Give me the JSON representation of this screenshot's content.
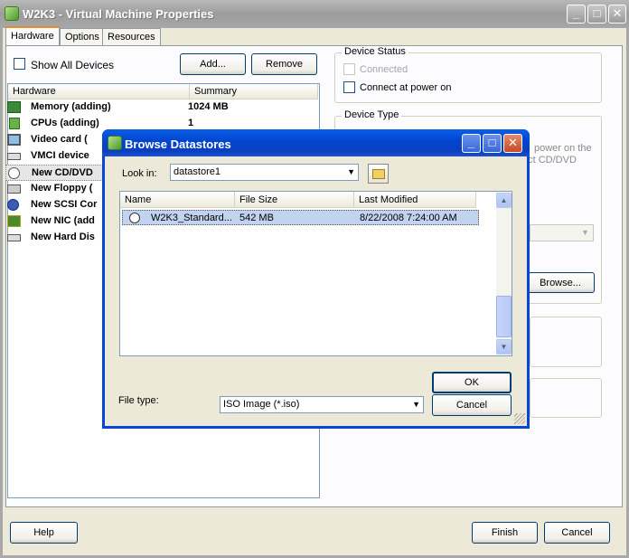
{
  "main_window": {
    "title": "W2K3 - Virtual Machine Properties",
    "caption_buttons": [
      "minimize-icon",
      "maximize-icon",
      "close-icon"
    ],
    "tabs": [
      {
        "label": "Hardware",
        "active": true
      },
      {
        "label": "Options",
        "active": false
      },
      {
        "label": "Resources",
        "active": false
      }
    ],
    "show_all_devices_label": "Show All Devices",
    "add_label": "Add...",
    "remove_label": "Remove",
    "hardware_list": {
      "columns": [
        "Hardware",
        "Summary"
      ],
      "rows": [
        {
          "icon": "memory-icon",
          "name": "Memory (adding)",
          "summary": "1024 MB"
        },
        {
          "icon": "cpu-icon",
          "name": "CPUs (adding)",
          "summary": "1"
        },
        {
          "icon": "monitor-icon",
          "name": "Video card  (",
          "summary": ""
        },
        {
          "icon": "vmci-icon",
          "name": "VMCI device",
          "summary": ""
        },
        {
          "icon": "cd-dvd-icon",
          "name": "New CD/DVD",
          "summary": "",
          "selected": true
        },
        {
          "icon": "floppy-icon",
          "name": "New Floppy (",
          "summary": ""
        },
        {
          "icon": "scsi-icon",
          "name": "New SCSI Cor",
          "summary": ""
        },
        {
          "icon": "nic-icon",
          "name": "New NIC (add",
          "summary": ""
        },
        {
          "icon": "hard-disk-icon",
          "name": "New Hard Dis",
          "summary": ""
        }
      ]
    },
    "device_status": {
      "label": "Device Status",
      "connected_label": "Connected",
      "connect_at_power_on_label": "Connect at power on"
    },
    "device_type": {
      "label": "Device Type",
      "partial_text_1": "power on the",
      "partial_text_2": "ect CD/DVD"
    },
    "browse_label": "Browse...",
    "help_label": "Help",
    "finish_label": "Finish",
    "cancel_label": "Cancel"
  },
  "dialog": {
    "title": "Browse Datastores",
    "look_in_label": "Look in:",
    "look_in_value": "datastore1",
    "up_folder_icon": "up-folder-icon",
    "file_list": {
      "columns": [
        "Name",
        "File Size",
        "Last Modified"
      ],
      "rows": [
        {
          "name": "W2K3_Standard...",
          "size": "542 MB",
          "modified": "8/22/2008 7:24:00 AM"
        }
      ]
    },
    "file_type_label": "File type:",
    "file_type_value": "ISO Image (*.iso)",
    "ok_label": "OK",
    "cancel_label": "Cancel"
  }
}
